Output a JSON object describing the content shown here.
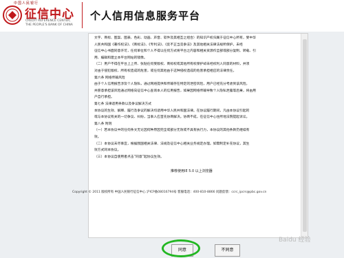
{
  "header": {
    "logo_top": "中国人民银行",
    "logo_cn": "征信中心",
    "logo_en1": "CREDIT REFERENCE CENTER,",
    "logo_en2": "THE PEOPLE'S BANK OF CHINA",
    "site_title": "个人信用信息服务平台"
  },
  "document": {
    "paragraphs": [
      "文字、商标、图案、图表、色彩、动画、声音、软件及其相互之组合）的知识产权归属于征信中心所有，受中华",
      "人民共和国《著作权法》、《商标法》、《专利法》、《反不正当竞争法》及其他相关法律法规所保护。未经",
      "征信中心书面同意许可，任何单位和个人不得以任何方式将平台之内容和相关资源作全部或部分复制、转载、引",
      "用、编辑和建立本平台网站的镜像。",
      "（二）用户不得在平台上上传、张贴任何受版权、商标权或其他所有权保护却未经权利人同意的材料，并须",
      "对由于侵犯版权、所有权造成的危害，或任何其他由于这种侵权造成的危害承担相应的法律责任。",
      "第六条 网络传输风险",
      "由于个人信用报告涉及个人隐私，通过网络提供和传输存在特定的泄密风险，用户已经充分考虑到该风险，",
      "并愿意承担该风险通过网络向征信中心查询本人的信用报告，如果因网络传输导致个人隐私泄露等后果，将由用",
      "户自行承担。",
      "第七条 法律适用条款以及争议解决方式",
      "本协议的生效、解释、履行及争议的解决均适用中华人民共和国法律。在协议履行期间，凡由本协议引起的",
      "或与本协议有关的一切争议、纠纷，当事人应首先协商解决。协商不成，在征信中心住所地法院提起诉讼。",
      "第八条 附则",
      "（一）若本协议中的任何条文无论因何种原因完全或部分无效或不具有执行力，本协议的其他条款仍继续有",
      "效。",
      "（二）本协议未尽事宜，根据我国相关法律、法规及征信中心相关业务规定办理。如需制定补充协议，其生",
      "效方式同本协议。",
      "（三）本协议自使用者点击“同意”起协议生效。"
    ],
    "overlay_line": "推荐使用IE 5.0 以上浏览器",
    "copyright": "Copyright © 2011 版权所有 中国人民银行征信中心 沪ICP备08016794号 客服电话：400-810-8866 问题反馈：ccrc_ipcrs@pbc.gov.cn"
  },
  "buttons": {
    "agree": "同意",
    "disagree": "不同意"
  },
  "watermark": "Baidu 经验",
  "colors": {
    "brand_red": "#c0181b",
    "highlight_green": "#22b722"
  }
}
